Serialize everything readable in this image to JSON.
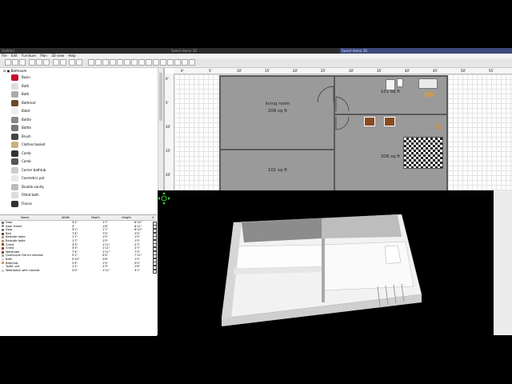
{
  "titlebar": {
    "left": "Untitled",
    "middle": "Sweet Home 3D",
    "right": "Sweet Home 3D"
  },
  "menu": [
    "File",
    "Edit",
    "Furniture",
    "Plan",
    "3D view",
    "Help"
  ],
  "catalog": {
    "root": "Bathroom",
    "items": [
      "Basin",
      "Bath",
      "Bath",
      "Bathmat",
      "Bidet",
      "Bottle",
      "Bottle",
      "Brush",
      "Clothes basket",
      "Comb",
      "Comb",
      "Corner bathtub",
      "Cosmetics pot",
      "Double vanity",
      "Fitted bath",
      "Flacon"
    ]
  },
  "furniture_table": {
    "columns": [
      "Name",
      "Width",
      "Depth",
      "Height",
      "V"
    ],
    "rows": [
      [
        "Door",
        "3'1\"",
        "1'7\"",
        "6'10\""
      ],
      [
        "Door frame",
        "3'",
        "1'8\"",
        "6'11\""
      ],
      [
        "Door",
        "3'1\"",
        "1'7\"",
        "6'10\""
      ],
      [
        "Bed",
        "7'4\"",
        "7'5\"",
        "2'5\""
      ],
      [
        "Bedside table",
        "1'7\"",
        "1'5\"",
        "1'5\""
      ],
      [
        "Bedside table",
        "1'7\"",
        "1'5\"",
        "1'5\""
      ],
      [
        "Chest",
        "3'3\"",
        "1'11\"",
        "2'7\""
      ],
      [
        "Chest",
        "3'3\"",
        "1'11\"",
        "2'7\""
      ],
      [
        "Wardrobe",
        "7'4\"",
        "1'11\"",
        "7'3\""
      ],
      [
        "Quadruple French window",
        "5'1\"",
        "0'4\"",
        "7'11\""
      ],
      [
        "Bath",
        "5'10\"",
        "2'6\"",
        "1'9\""
      ],
      [
        "Bathmat",
        "2'4\"",
        "1'5\"",
        "0'0\""
      ],
      [
        "Toilet unit",
        "1'1\"",
        "2'3\"",
        "2'8\""
      ],
      [
        "Washbasin with cabinet",
        "2'0\"",
        "1'11\"",
        "3'1\""
      ]
    ]
  },
  "plan": {
    "ruler_top": [
      "0'",
      "5'",
      "10'",
      "15'",
      "20'",
      "25'",
      "30'",
      "35'",
      "40'",
      "45'",
      "50'",
      "55'",
      "60'"
    ],
    "ruler_left": [
      "0'",
      "5'",
      "10'",
      "15'",
      "20'",
      "25'"
    ],
    "rooms": [
      {
        "name": "living room",
        "area": "208 sq ft"
      },
      {
        "name": "",
        "area": "101 sq ft"
      },
      {
        "name": "",
        "area": "208 sq ft"
      },
      {
        "name": "",
        "area": "101 sq ft"
      }
    ]
  },
  "colors": {
    "room_fill": "#9a9a9a",
    "wall": "#5a5a5a",
    "view_bg": "#000000",
    "accent_title": "#3c4a7a"
  }
}
